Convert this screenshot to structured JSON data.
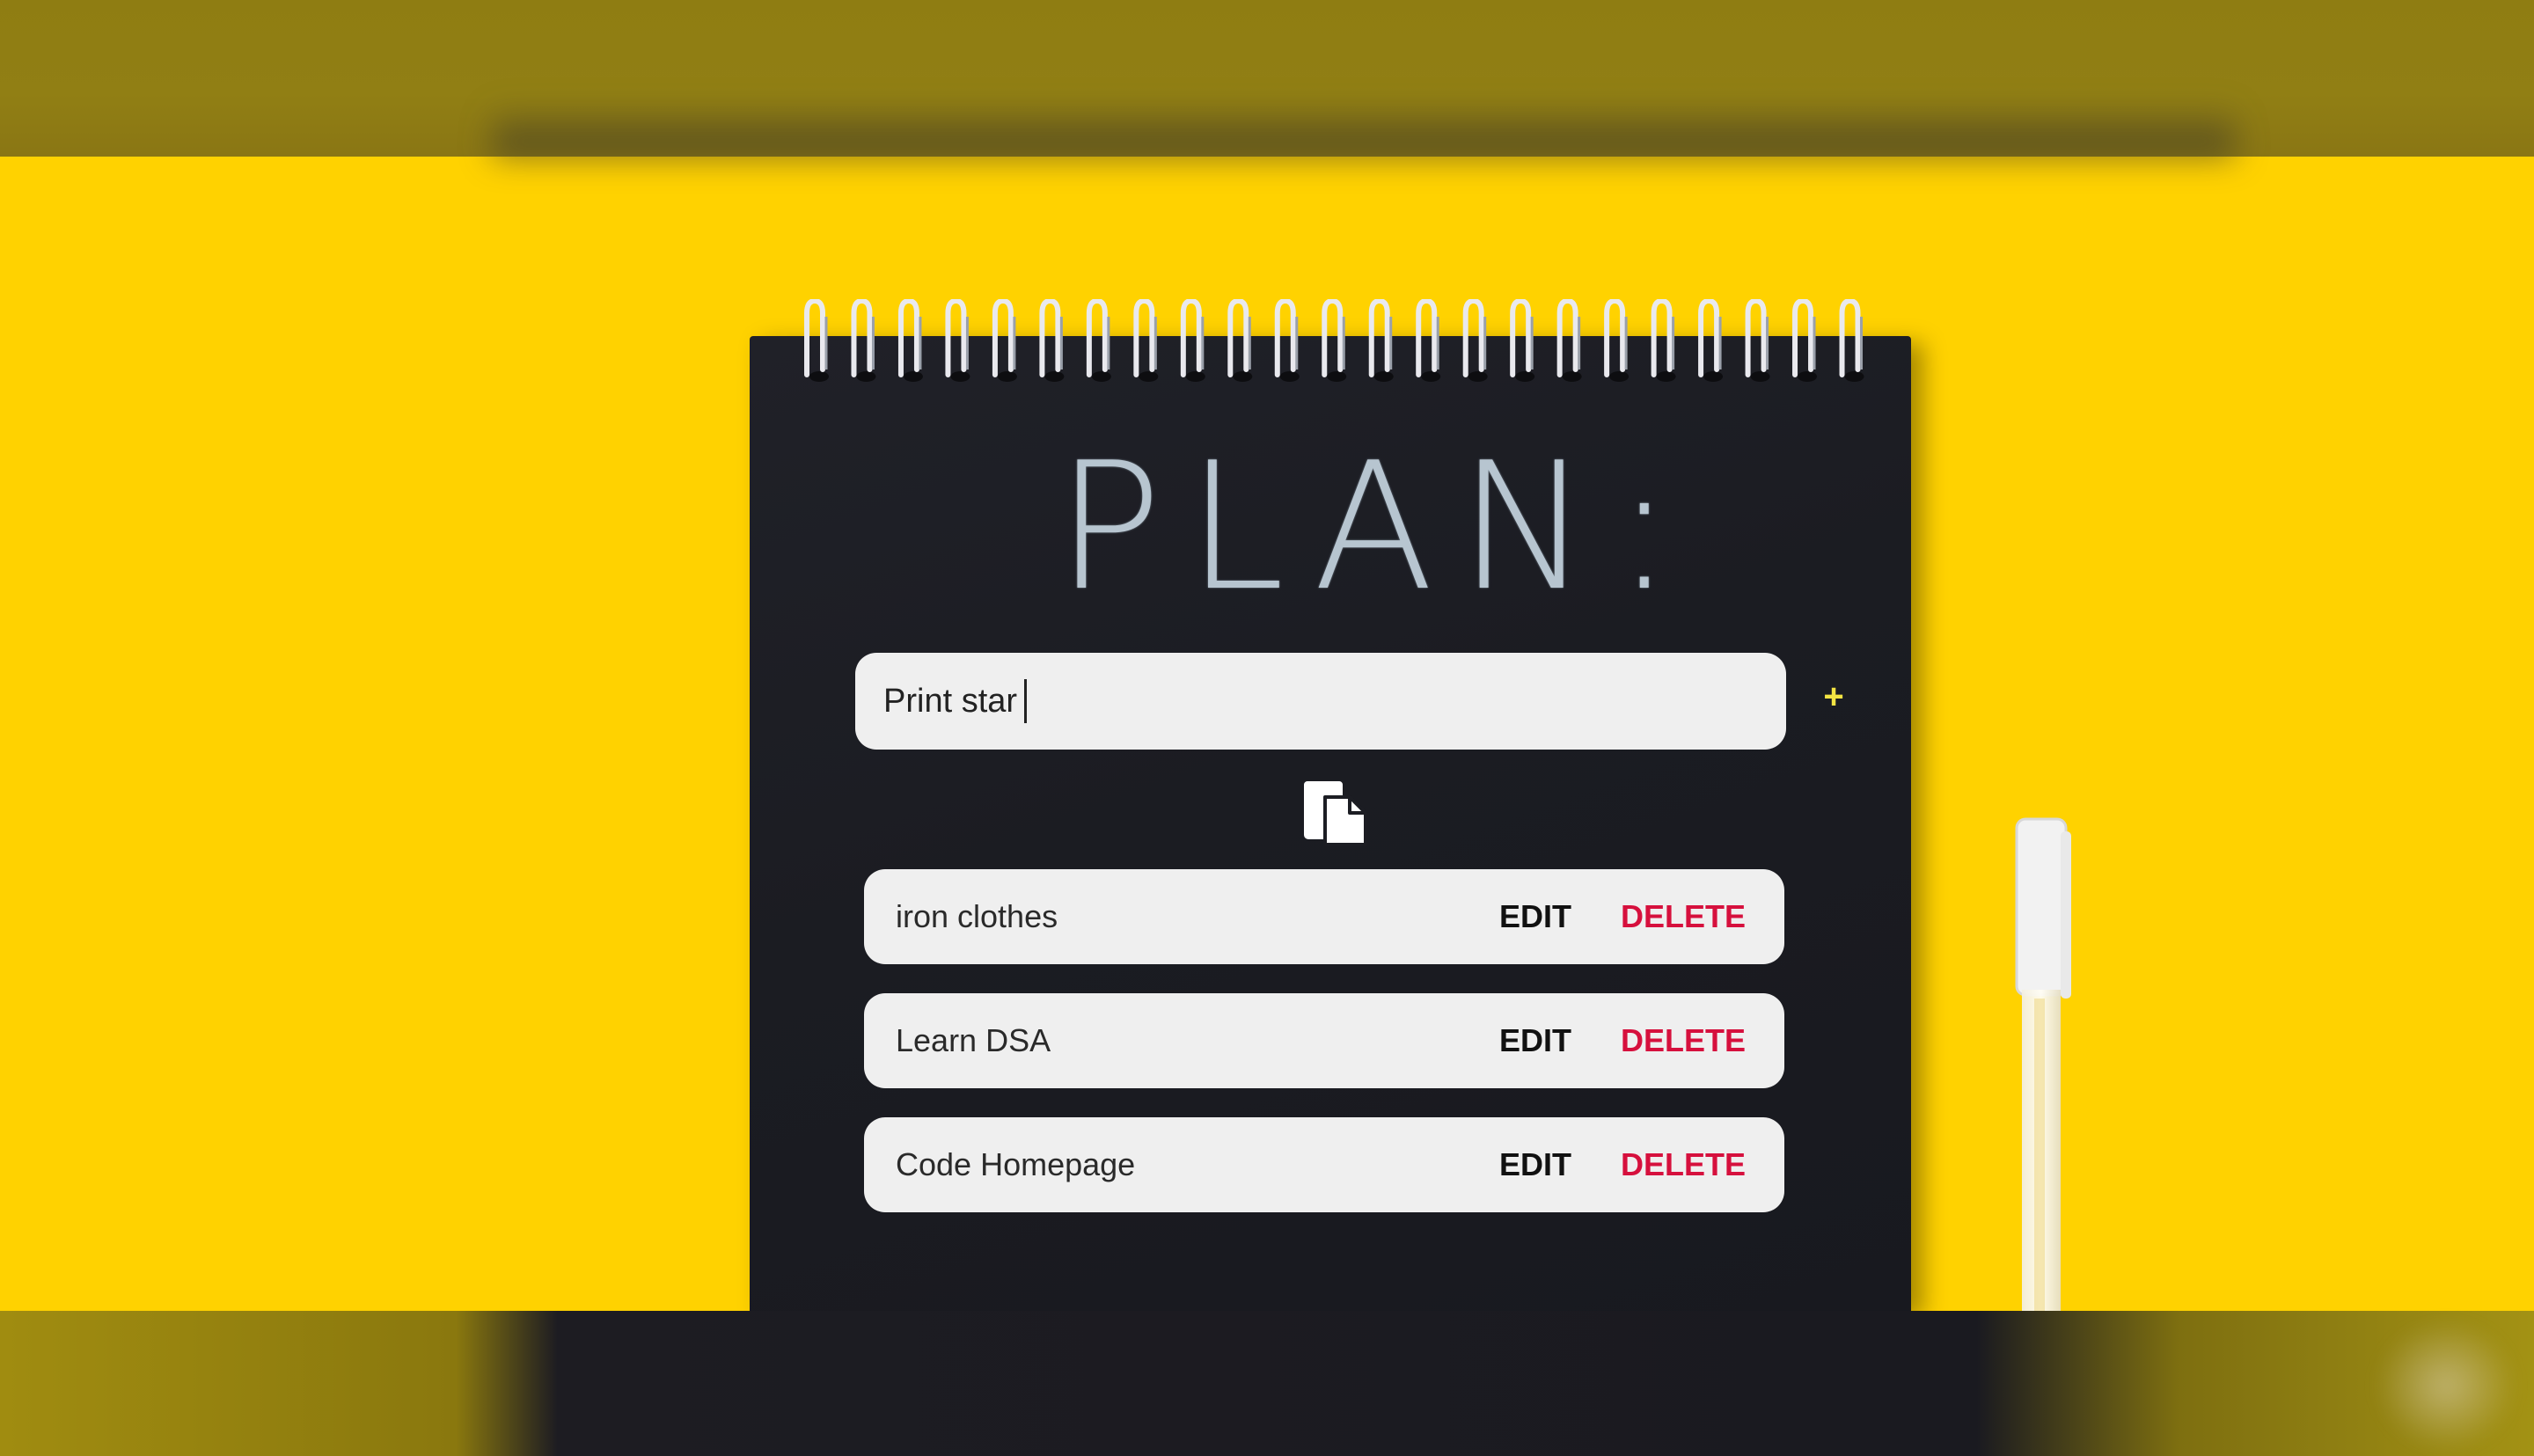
{
  "title": "PLAN:",
  "input": {
    "value": "Print star",
    "placeholder": ""
  },
  "add_button": {
    "label": "+"
  },
  "copy_icon": "copy-icon",
  "todos": [
    {
      "text": "iron clothes",
      "edit_label": "EDIT",
      "delete_label": "DELETE"
    },
    {
      "text": "Learn DSA",
      "edit_label": "EDIT",
      "delete_label": "DELETE"
    },
    {
      "text": "Code Homepage",
      "edit_label": "EDIT",
      "delete_label": "DELETE"
    }
  ],
  "colors": {
    "background": "#ffd200",
    "notebook": "#1c1d23",
    "title": "#b7c5d0",
    "item_background": "#efefef",
    "delete": "#d6103d",
    "add": "#f3e443"
  }
}
